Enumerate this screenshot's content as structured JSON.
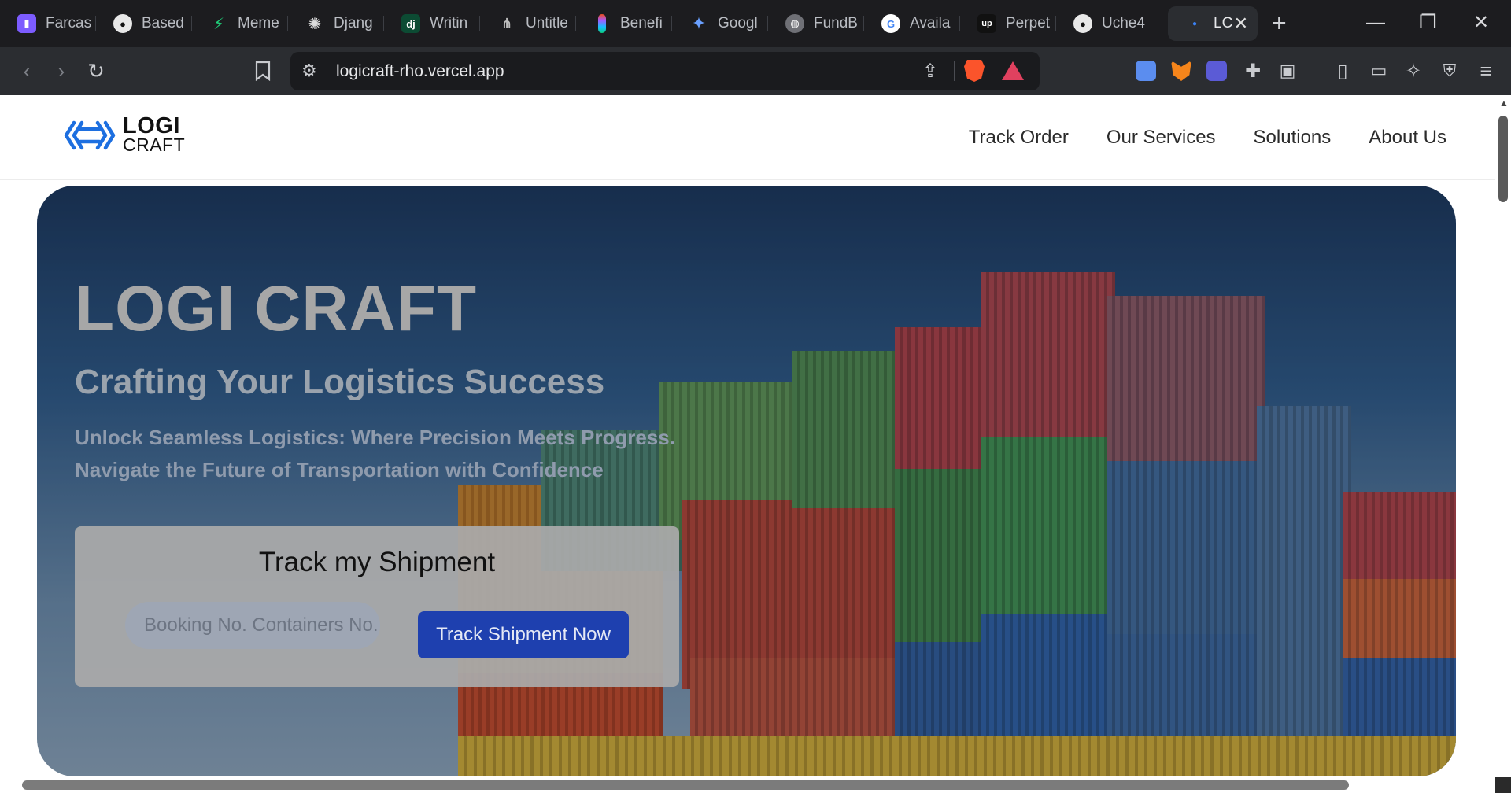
{
  "browser": {
    "tabs": [
      {
        "label": "Farcas",
        "icon": "farcaster-icon",
        "color": "#7c5cff"
      },
      {
        "label": "Based",
        "icon": "github-icon",
        "color": "#24292f"
      },
      {
        "label": "Meme",
        "icon": "bolt-icon",
        "color": "#1fb86a"
      },
      {
        "label": "Djang",
        "icon": "openai-icon",
        "color": "#3a3a3a"
      },
      {
        "label": "Writin",
        "icon": "django-icon",
        "color": "#0c4b33"
      },
      {
        "label": "Untitle",
        "icon": "network-icon",
        "color": "#444"
      },
      {
        "label": "Benefi",
        "icon": "figma-icon",
        "color": "#f24e1e"
      },
      {
        "label": "Googl",
        "icon": "gemini-icon",
        "color": "#4a7cf5"
      },
      {
        "label": "FundB",
        "icon": "globe-icon",
        "color": "#555"
      },
      {
        "label": "Availa",
        "icon": "google-icon",
        "color": "#ffffff"
      },
      {
        "label": "Perpet",
        "icon": "upwork-icon",
        "color": "#1a1a1a"
      },
      {
        "label": "Uche4",
        "icon": "github-icon",
        "color": "#24292f"
      },
      {
        "label": "LC",
        "icon": "loading-dot-icon",
        "color": "#2b2d31"
      }
    ],
    "url": "logicraft-rho.vercel.app"
  },
  "site": {
    "logo": {
      "line1": "LOGI",
      "line2": "CRAFT",
      "color": "#1d6fe0"
    },
    "nav": [
      "Track Order",
      "Our Services",
      "Solutions",
      "About Us"
    ]
  },
  "hero": {
    "title": "LOGI CRAFT",
    "subtitle": "Crafting Your Logistics Success",
    "description_line1": "Unlock Seamless Logistics: Where Precision Meets Progress.",
    "description_line2": "Navigate the Future of Transportation with Confidence",
    "track": {
      "title": "Track my Shipment",
      "placeholder": "Booking No. Containers No.",
      "button": "Track Shipment Now"
    }
  }
}
